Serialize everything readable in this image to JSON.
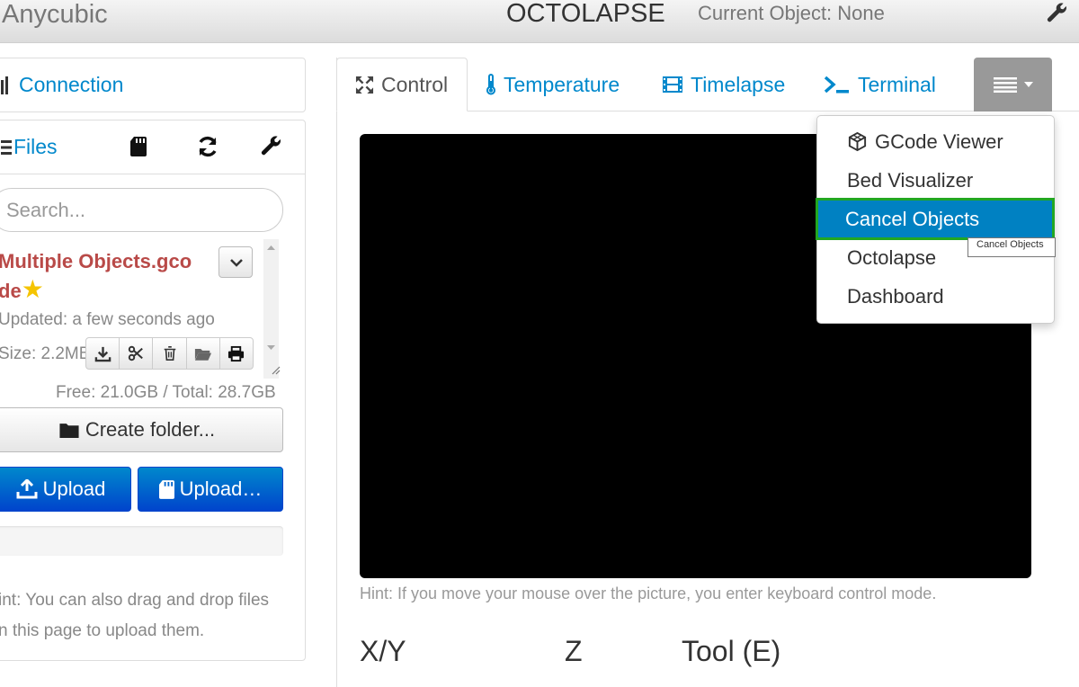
{
  "navbar": {
    "brand": "Anycubic",
    "octolapse_title": "OCTOLAPSE",
    "current_object": "Current Object: None",
    "icons": [
      "wrench-icon"
    ]
  },
  "sidebar": {
    "connection": {
      "label": "Connection",
      "icon": "signal-icon"
    },
    "files": {
      "label": "Files",
      "header_icons": [
        "list-icon",
        "sd-card-icon",
        "refresh-icon",
        "wrench-icon"
      ],
      "search_placeholder": "Search...",
      "file": {
        "name_line1": "Multiple Objects.gco",
        "name_line2": "de",
        "star": "★",
        "updated": "Updated: a few seconds ago",
        "size": "Size: 2.2MB",
        "action_icons": [
          "download-icon",
          "scissors-icon",
          "trash-icon",
          "folder-open-icon",
          "print-icon"
        ]
      },
      "free_space": "Free: 21.0GB / Total: 28.7GB",
      "create_folder": "Create folder...",
      "upload": "Upload",
      "upload_sd": "Upload…",
      "hint_line1": "int: You can also drag and drop files",
      "hint_line2": "n this page to upload them."
    }
  },
  "tabs": [
    {
      "label": "Control",
      "icon": "arrows-expand-icon",
      "active": true
    },
    {
      "label": "Temperature",
      "icon": "thermometer-icon",
      "active": false
    },
    {
      "label": "Timelapse",
      "icon": "film-icon",
      "active": false
    },
    {
      "label": "Terminal",
      "icon": "terminal-icon",
      "active": false
    }
  ],
  "tab_menu": {
    "icon": "menu-icon"
  },
  "dropdown": [
    {
      "label": "GCode Viewer",
      "icon": "cube-icon"
    },
    {
      "label": "Bed Visualizer"
    },
    {
      "label": "Cancel Objects",
      "active": true
    },
    {
      "label": "Octolapse"
    },
    {
      "label": "Dashboard"
    }
  ],
  "tooltip": "Cancel Objects",
  "control": {
    "webcam_hint": "Hint: If you move your mouse over the picture, you enter keyboard control mode.",
    "labels": [
      "X/Y",
      "Z",
      "Tool (E)"
    ]
  },
  "colors": {
    "link": "#0088cc",
    "file_name": "#b94a48",
    "highlight": "#0081c2",
    "focus_border": "#22a722"
  }
}
